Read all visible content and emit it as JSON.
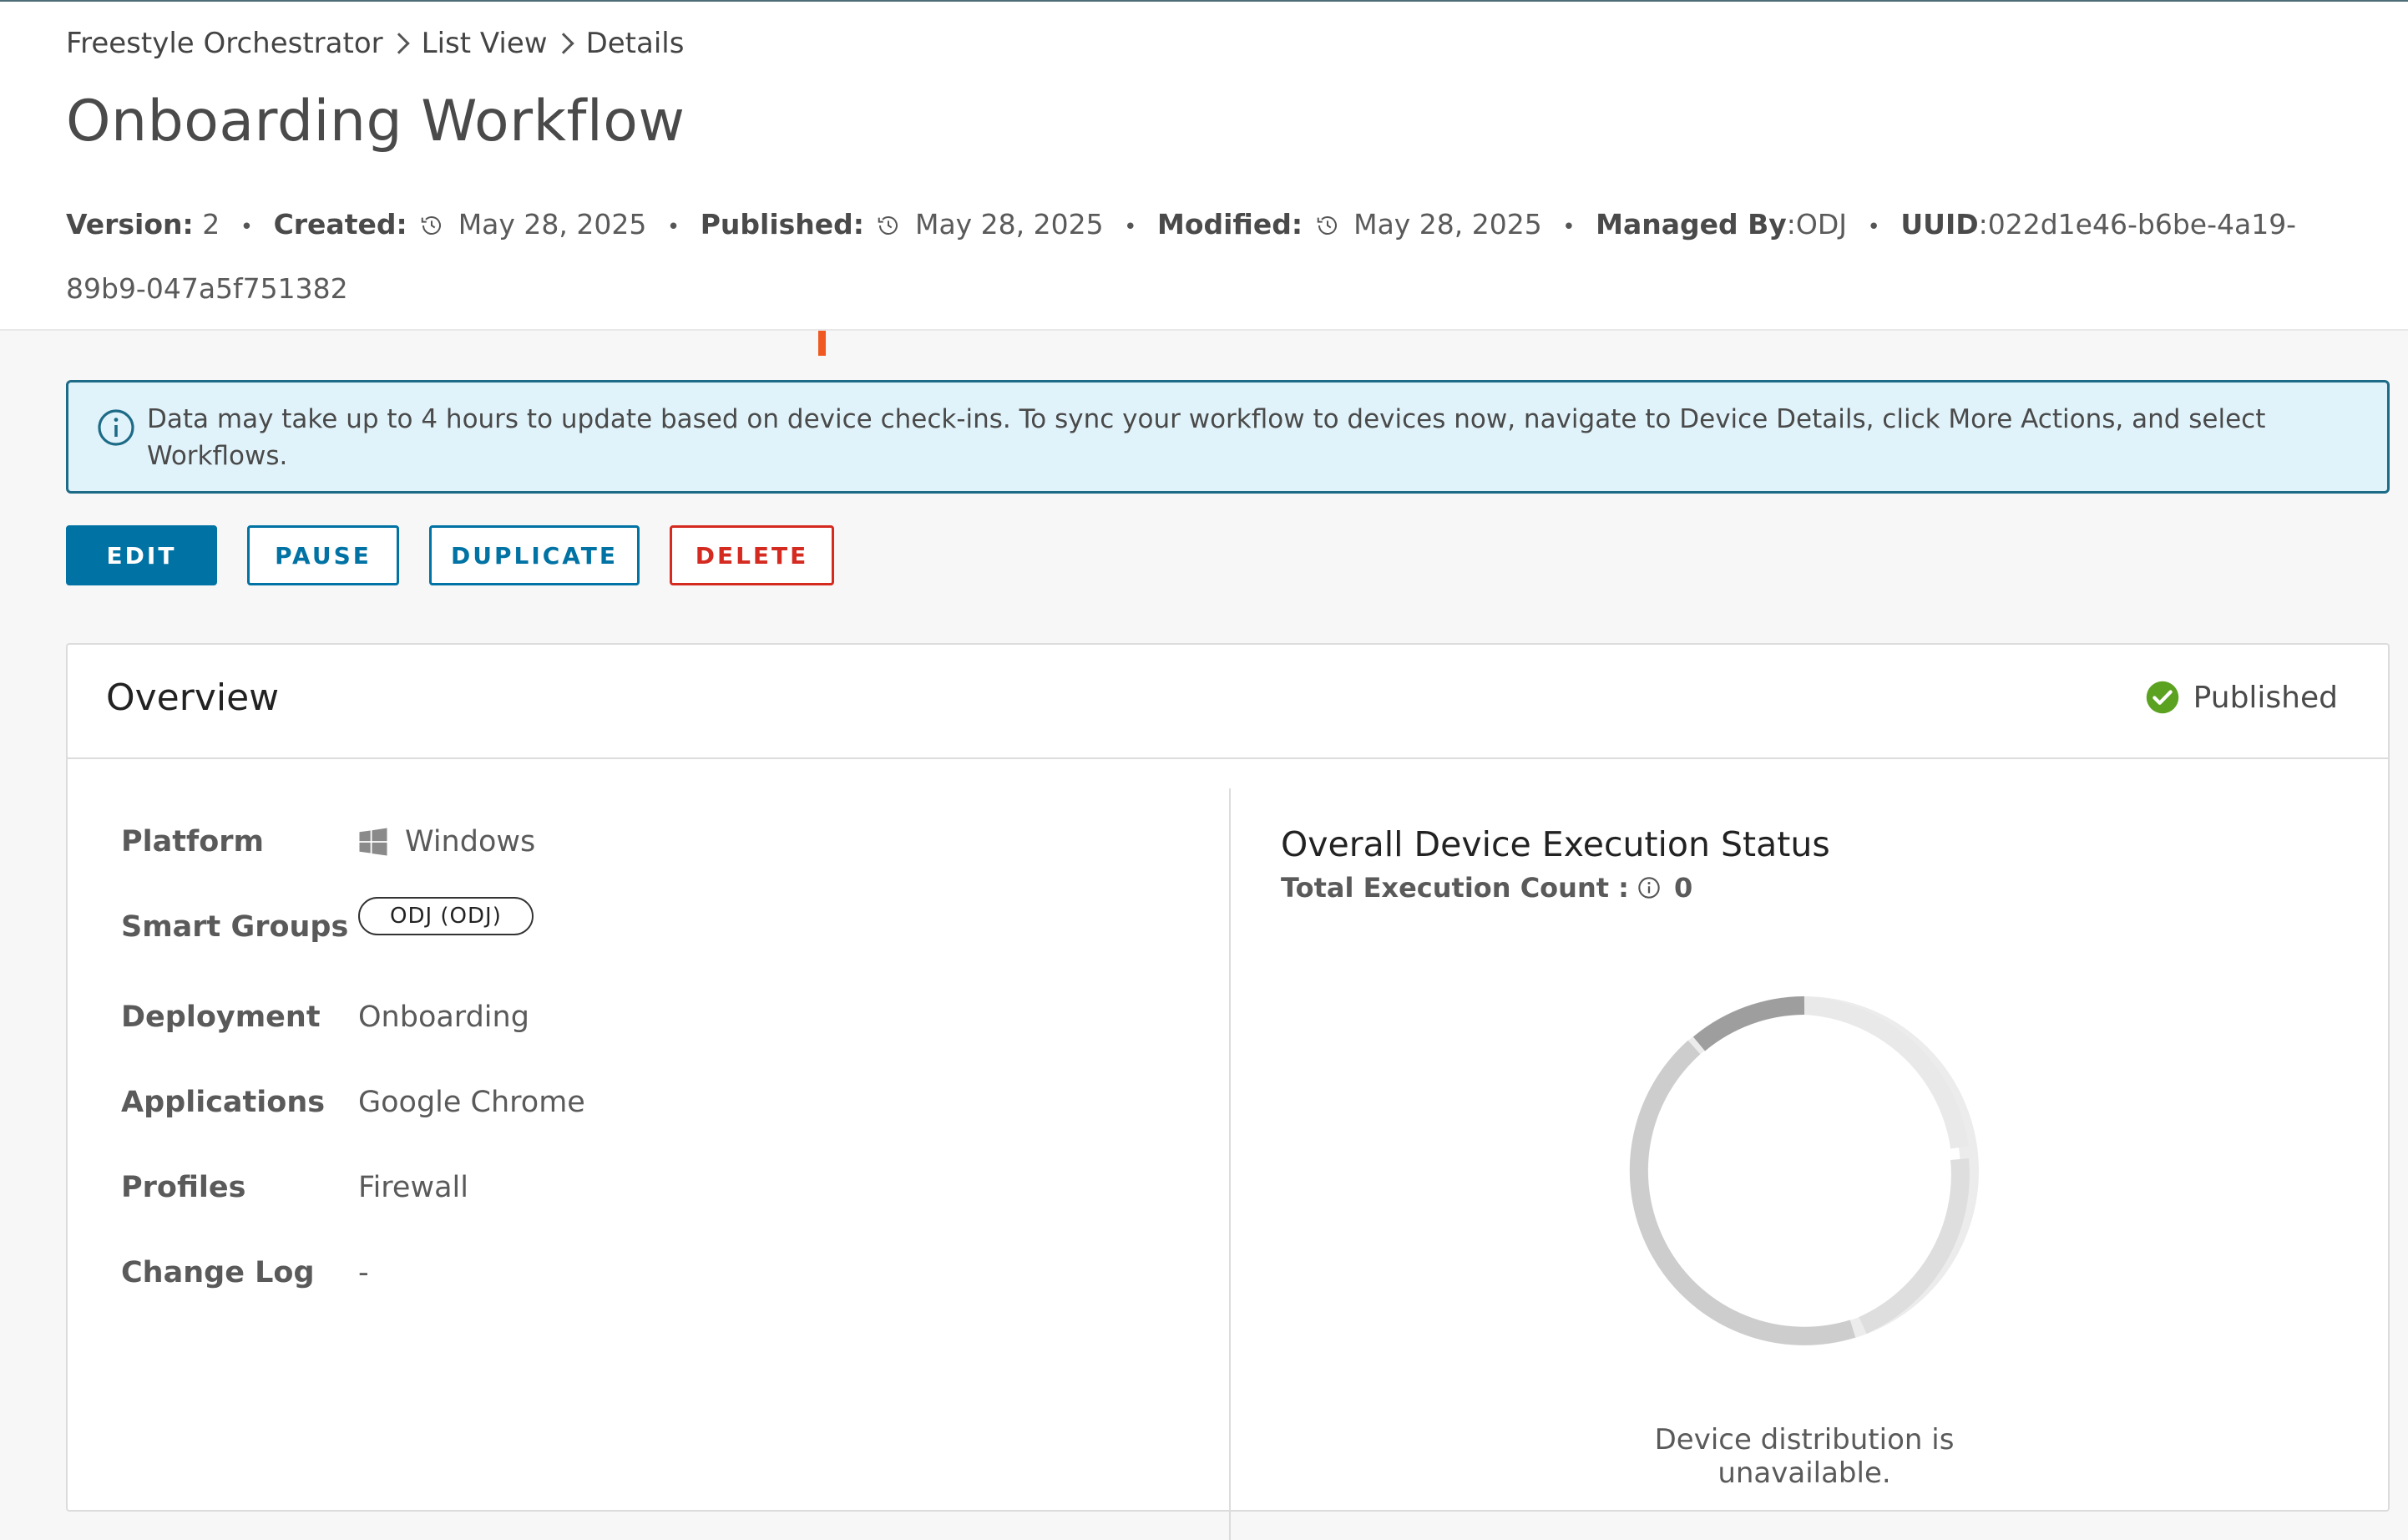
{
  "breadcrumb": {
    "items": [
      "Freestyle Orchestrator",
      "List View",
      "Details"
    ]
  },
  "page": {
    "title": "Onboarding Workflow"
  },
  "meta": {
    "version_label": "Version:",
    "version_value": "2",
    "created_label": "Created:",
    "created_value": "May 28, 2025",
    "published_label": "Published:",
    "published_value": "May 28, 2025",
    "modified_label": "Modified:",
    "modified_value": "May 28, 2025",
    "managed_label": "Managed By",
    "managed_value": ":ODJ",
    "uuid_label": "UUID",
    "uuid_value": ":022d1e46-b6be-4a19-89b9-047a5f751382",
    "separator": "•",
    "icon": "history-icon"
  },
  "alert": {
    "text": "Data may take up to 4 hours to update based on device check-ins. To sync your workflow to devices now, navigate to Device Details, click More Actions, and select Workflows.",
    "icon": "info-icon",
    "color": "#1d6b87",
    "background": "#e1f3fa"
  },
  "actions": {
    "edit": "EDIT",
    "pause": "PAUSE",
    "duplicate": "DUPLICATE",
    "delete": "DELETE",
    "primary_color": "#0072a3",
    "danger_color": "#d42a20"
  },
  "overview": {
    "title": "Overview",
    "status": "Published",
    "status_icon": "check-circle-icon",
    "status_color": "#5aa220",
    "details": [
      {
        "label": "Platform",
        "value": "Windows",
        "icon": "windows-icon"
      },
      {
        "label": "Smart Groups",
        "value": "ODJ (ODJ)"
      },
      {
        "label": "Deployment",
        "value": "Onboarding"
      },
      {
        "label": "Applications",
        "value": "Google Chrome"
      },
      {
        "label": "Profiles",
        "value": "Firewall"
      },
      {
        "label": "Change Log",
        "value": "-"
      }
    ]
  },
  "execution": {
    "title": "Overall Device Execution Status",
    "count_label": "Total Execution Count :",
    "count_value": "0",
    "empty_message": "Device distribution is unavailable."
  }
}
